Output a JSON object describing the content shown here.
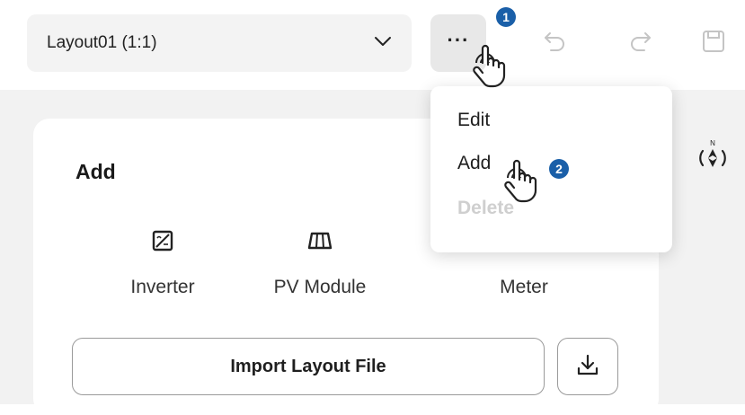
{
  "toolbar": {
    "layout_select_value": "Layout01 (1:1)",
    "more_label": "···"
  },
  "menu": {
    "items": [
      {
        "label": "Edit",
        "enabled": true
      },
      {
        "label": "Add",
        "enabled": true
      },
      {
        "label": "Delete",
        "enabled": false
      }
    ]
  },
  "add_panel": {
    "title": "Add",
    "devices": [
      {
        "label": "Inverter",
        "icon": "inverter-icon"
      },
      {
        "label": "PV Module",
        "icon": "pv-module-icon"
      },
      {
        "label": "Meter",
        "icon": "meter-icon"
      }
    ],
    "import_label": "Import Layout File"
  },
  "compass": {
    "north_label": "N"
  },
  "steps": {
    "one": "1",
    "two": "2"
  },
  "colors": {
    "step_badge": "#1a5fa8",
    "panel_bg": "#f2f2f2",
    "select_bg": "#f3f3f3",
    "disabled_text": "#cfcfcf"
  }
}
